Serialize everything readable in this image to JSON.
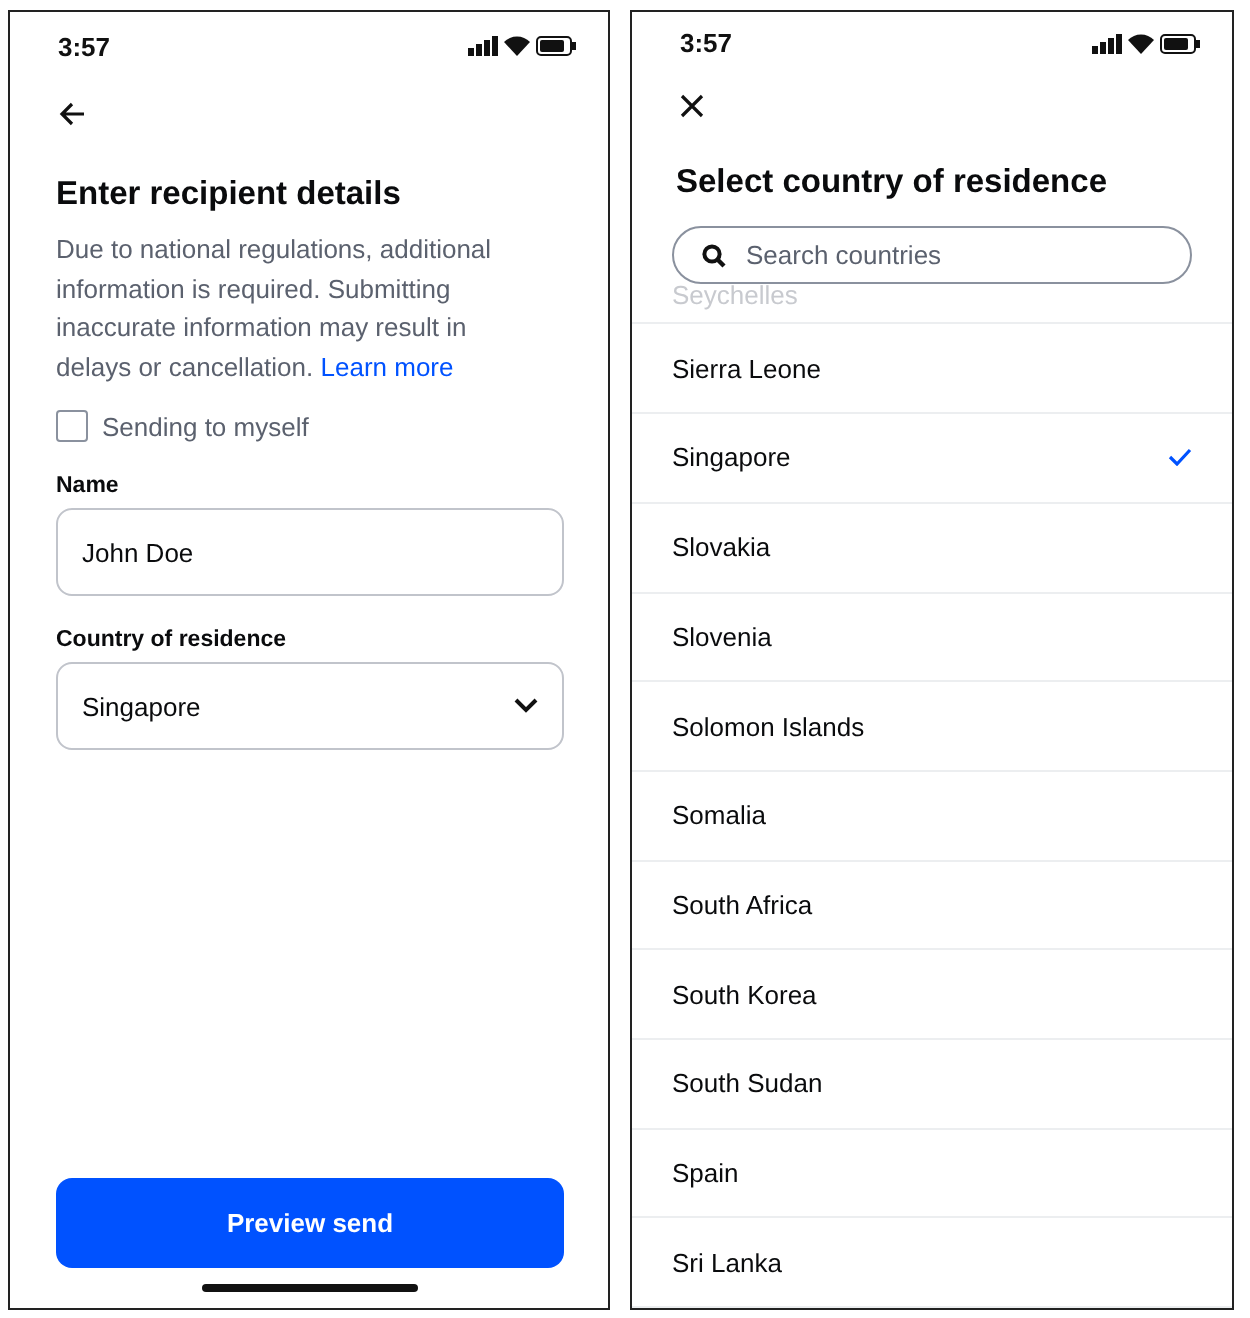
{
  "left_screen": {
    "status_bar": {
      "time": "3:57"
    },
    "title": "Enter recipient details",
    "notice": "Due to national regulations, additional information is required. Submitting inaccurate information may result in delays or cancellation.",
    "notice_link": "Learn more",
    "self_checkbox": {
      "label": "Sending to myself",
      "checked": false
    },
    "name_field": {
      "label": "Name",
      "value": "John Doe"
    },
    "country_field": {
      "label": "Country of residence",
      "value": "Singapore"
    },
    "primary_button": "Preview send"
  },
  "right_screen": {
    "status_bar": {
      "time": "3:57"
    },
    "title": "Select country of residence",
    "search": {
      "placeholder": "Search countries"
    },
    "faded_item": "Seychelles",
    "countries": [
      {
        "name": "Sierra Leone",
        "selected": false
      },
      {
        "name": "Singapore",
        "selected": true
      },
      {
        "name": "Slovakia",
        "selected": false
      },
      {
        "name": "Slovenia",
        "selected": false
      },
      {
        "name": "Solomon Islands",
        "selected": false
      },
      {
        "name": "Somalia",
        "selected": false
      },
      {
        "name": "South Africa",
        "selected": false
      },
      {
        "name": "South Korea",
        "selected": false
      },
      {
        "name": "South Sudan",
        "selected": false
      },
      {
        "name": "Spain",
        "selected": false
      },
      {
        "name": "Sri Lanka",
        "selected": false
      }
    ]
  }
}
